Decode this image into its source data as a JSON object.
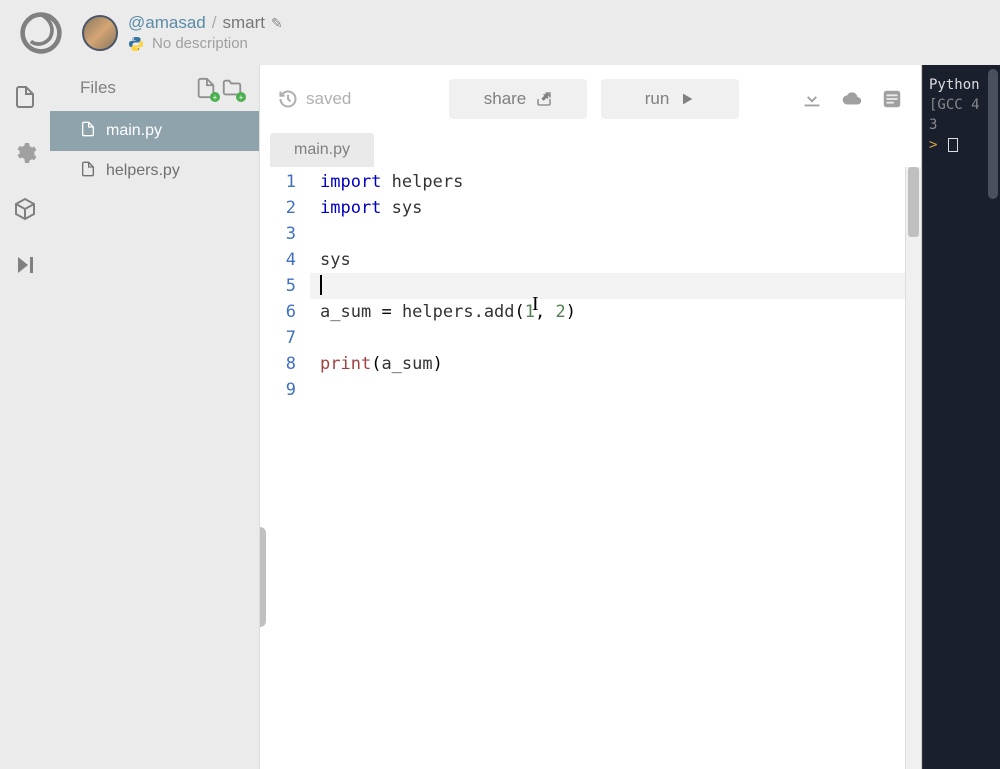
{
  "header": {
    "username": "@amasad",
    "separator": "/",
    "project": "smart",
    "description": "No description"
  },
  "files": {
    "label": "Files",
    "items": [
      {
        "name": "main.py",
        "active": true
      },
      {
        "name": "helpers.py",
        "active": false
      }
    ]
  },
  "toolbar": {
    "saved": "saved",
    "share": "share",
    "run": "run"
  },
  "tabs": {
    "active": "main.py"
  },
  "code": {
    "lines": [
      {
        "n": "1",
        "tokens": [
          [
            "kw",
            "import"
          ],
          [
            "sp",
            " "
          ],
          [
            "id",
            "helpers"
          ]
        ]
      },
      {
        "n": "2",
        "tokens": [
          [
            "kw",
            "import"
          ],
          [
            "sp",
            " "
          ],
          [
            "id",
            "sys"
          ]
        ]
      },
      {
        "n": "3",
        "tokens": []
      },
      {
        "n": "4",
        "tokens": [
          [
            "id",
            "sys"
          ]
        ]
      },
      {
        "n": "5",
        "tokens": [],
        "active": true,
        "cursor": true
      },
      {
        "n": "6",
        "tokens": [
          [
            "id",
            "a_sum"
          ],
          [
            "sp",
            " "
          ],
          [
            "op",
            "="
          ],
          [
            "sp",
            " "
          ],
          [
            "id",
            "helpers.add"
          ],
          [
            "op",
            "("
          ],
          [
            "num",
            "1"
          ],
          [
            "op",
            ","
          ],
          [
            "sp",
            " "
          ],
          [
            "num",
            "2"
          ],
          [
            "op",
            ")"
          ]
        ]
      },
      {
        "n": "7",
        "tokens": []
      },
      {
        "n": "8",
        "tokens": [
          [
            "bi",
            "print"
          ],
          [
            "op",
            "("
          ],
          [
            "id",
            "a_sum"
          ],
          [
            "op",
            ")"
          ]
        ]
      },
      {
        "n": "9",
        "tokens": []
      }
    ]
  },
  "terminal": {
    "lines": [
      {
        "text": "Python",
        "cls": "term-white"
      },
      {
        "text": "[GCC 4",
        "cls": "line-dark"
      },
      {
        "text": "3",
        "cls": "line-dark"
      }
    ],
    "prompt": ">"
  }
}
